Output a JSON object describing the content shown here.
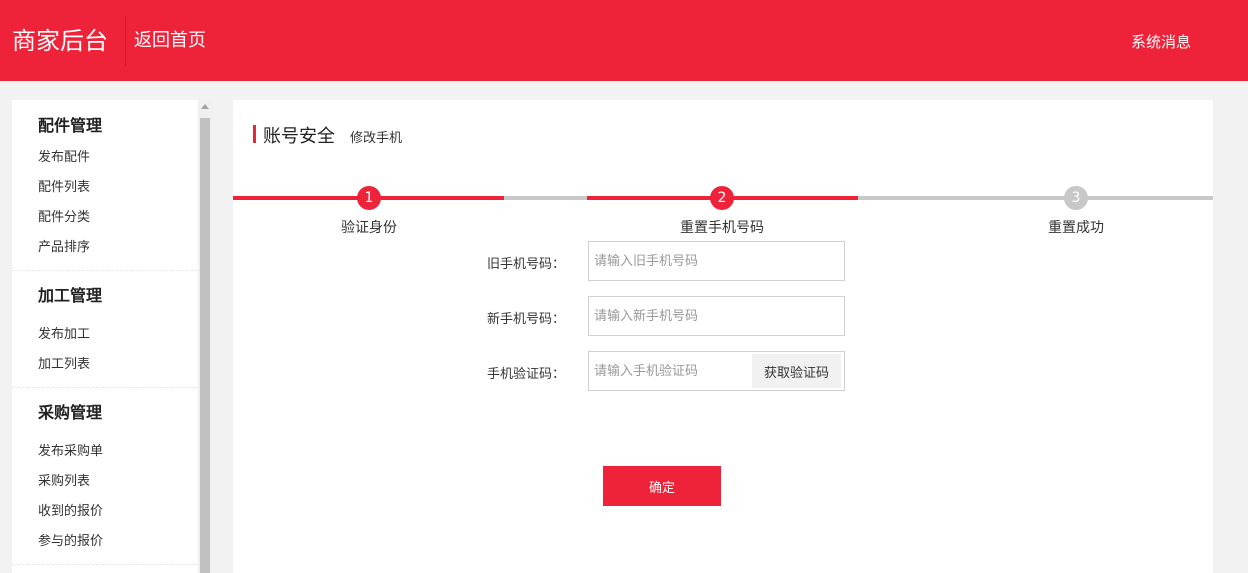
{
  "header": {
    "brand": "商家后台",
    "back_home": "返回首页",
    "system_messages": "系统消息"
  },
  "sidebar": {
    "groups": [
      {
        "title": "配件管理",
        "items": [
          "发布配件",
          "配件列表",
          "配件分类",
          "产品排序"
        ]
      },
      {
        "title": "加工管理",
        "items": [
          "发布加工",
          "加工列表"
        ]
      },
      {
        "title": "采购管理",
        "items": [
          "发布采购单",
          "采购列表",
          "收到的报价",
          "参与的报价"
        ]
      }
    ]
  },
  "page": {
    "title": "账号安全",
    "subtitle": "修改手机"
  },
  "steps": [
    {
      "number": "1",
      "label": "验证身份",
      "state": "done"
    },
    {
      "number": "2",
      "label": "重置手机号码",
      "state": "current"
    },
    {
      "number": "3",
      "label": "重置成功",
      "state": "todo"
    }
  ],
  "form": {
    "old_phone": {
      "label": "旧手机号码：",
      "value": "",
      "placeholder": "请输入旧手机号码"
    },
    "new_phone": {
      "label": "新手机号码：",
      "value": "",
      "placeholder": "请输入新手机号码"
    },
    "code": {
      "label": "手机验证码：",
      "value": "",
      "placeholder": "请输入手机验证码",
      "button": "获取验证码"
    },
    "submit": "确定"
  },
  "colors": {
    "accent": "#ee233a",
    "step_inactive": "#c8c8c8"
  }
}
